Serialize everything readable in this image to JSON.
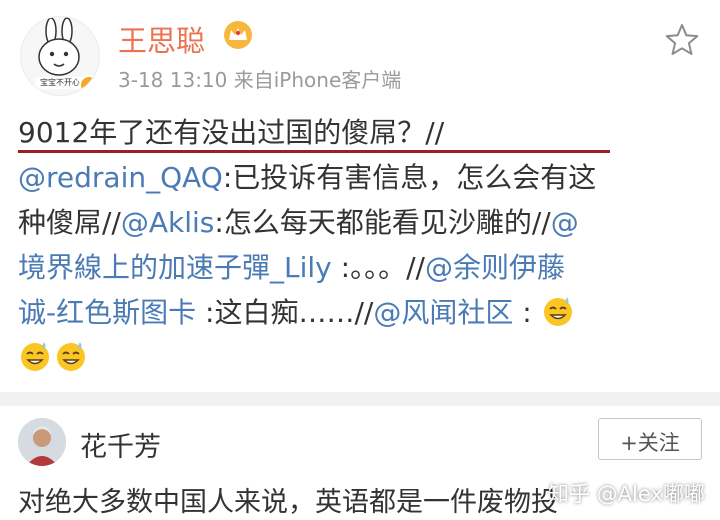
{
  "header": {
    "author_name": "王思聪",
    "meta": "3-18 13:10  来自iPhone客户端",
    "avatar_caption": "宝宝不开心"
  },
  "post": {
    "line1": {
      "text": "9012年了还有没出过国的傻屌？//"
    },
    "line2": {
      "mention": "@redrain_QAQ",
      "text": ":已投诉有害信息，怎么会有这"
    },
    "line3": {
      "text1": "种傻屌//",
      "mention1": "@Aklis",
      "text2": ":怎么每天都能看见沙雕的//",
      "mention2": "@"
    },
    "line4": {
      "mention1": "境界線上的加速子彈_Lily",
      "text1": " :。。。//",
      "mention2": "@余则伊藤"
    },
    "line5": {
      "mention1": "诚-红色斯图卡",
      "text1": " :这白痴……//",
      "mention2": "@风闻社区",
      "text2": " : "
    }
  },
  "comment": {
    "user_name": "花千芳",
    "follow_label": "+关注",
    "text": "对绝大多数中国人来说，英语都是一件废物投"
  },
  "watermark": "知乎 @Alex嘟嘟",
  "colors": {
    "author": "#eb7350",
    "mention": "#4a7bb5",
    "underline": "#9b1f24",
    "text": "#333333",
    "meta": "#9a9a9a"
  },
  "icons": {
    "crown": "vip-crown-icon",
    "star": "favorite-star-icon",
    "emoji": "grinning-sweat-emoji"
  }
}
